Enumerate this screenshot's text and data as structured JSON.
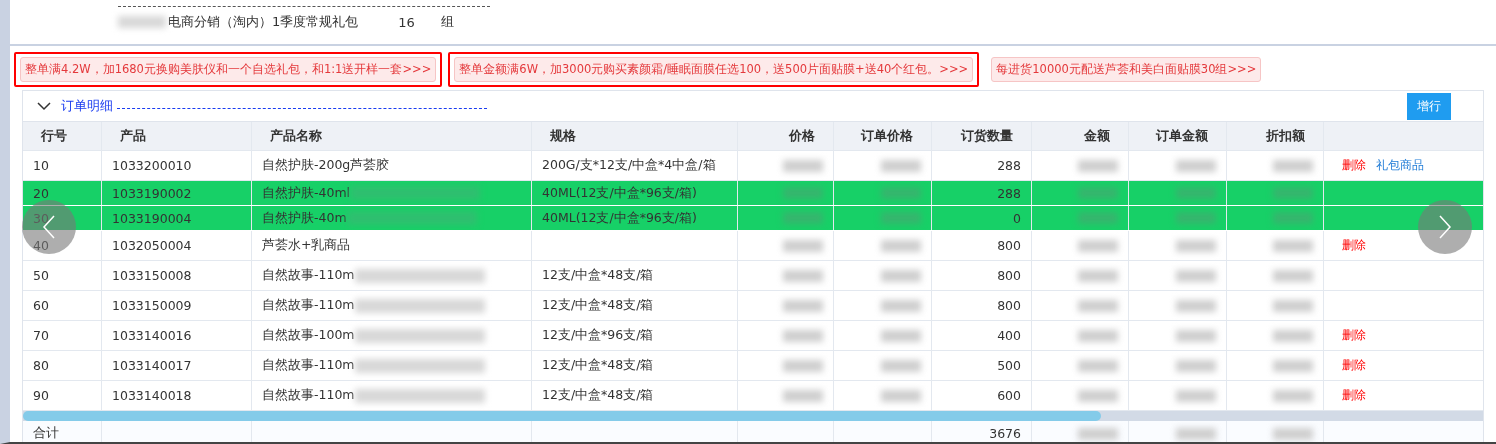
{
  "package": {
    "name": "电商分销（淘内）1季度常规礼包",
    "name_masked": true,
    "quantity": "16",
    "unit": "组"
  },
  "promotions": [
    {
      "text": "整单满4.2W，加1680元换购美肤仪和一个自选礼包，和1:1送开样一套>>>",
      "highlighted": true
    },
    {
      "text": "整单金额满6W，加3000元购买素颜霜/睡眠面膜任选100，送500片面贴膜+送40个红包。>>>",
      "highlighted": true
    },
    {
      "text": "每进货10000元配送芦荟和美白面贴膜30组>>>",
      "highlighted": false
    }
  ],
  "section": {
    "title": "订单明细",
    "expanded": true,
    "add_button": "增行"
  },
  "table": {
    "columns": [
      {
        "label": "行号",
        "masked": false
      },
      {
        "label": "产品",
        "masked": false
      },
      {
        "label": "产品名称",
        "masked": false
      },
      {
        "label": "规格",
        "masked": false
      },
      {
        "label": "价格",
        "masked": true
      },
      {
        "label": "订单价格",
        "masked": true
      },
      {
        "label": "订货数量",
        "masked": false
      },
      {
        "label": "金额",
        "masked": true
      },
      {
        "label": "订单金额",
        "masked": true
      },
      {
        "label": "折扣额",
        "masked": true
      }
    ],
    "rows": [
      {
        "line": "10",
        "product": "1033200010",
        "name": "自然护肤-200g芦荟胶",
        "name_masked": false,
        "spec": "200G/支*12支/中盒*4中盒/箱",
        "quantity": "288",
        "selected": false,
        "actions": [
          {
            "label": "删除",
            "kind": "delete"
          },
          {
            "label": "礼包商品",
            "kind": "link"
          }
        ]
      },
      {
        "line": "20",
        "product": "1033190002",
        "name": "自然护肤-40ml",
        "name_masked": true,
        "spec": "40ML(12支/中盒*96支/箱)",
        "quantity": "288",
        "selected": true,
        "actions": []
      },
      {
        "line": "30",
        "product": "1033190004",
        "name": "自然护肤-40m",
        "name_masked": true,
        "spec": "40ML(12支/中盒*96支/箱)",
        "quantity": "0",
        "selected": true,
        "actions": []
      },
      {
        "line": "40",
        "product": "1032050004",
        "name": "芦荟水+乳商品",
        "name_masked": false,
        "spec": "",
        "quantity": "800",
        "selected": false,
        "actions": [
          {
            "label": "删除",
            "kind": "delete"
          }
        ]
      },
      {
        "line": "50",
        "product": "1033150008",
        "name": "自然故事-110m",
        "name_masked": true,
        "spec": "12支/中盒*48支/箱",
        "quantity": "800",
        "selected": false,
        "actions": []
      },
      {
        "line": "60",
        "product": "1033150009",
        "name": "自然故事-110m",
        "name_masked": true,
        "spec": "12支/中盒*48支/箱",
        "quantity": "800",
        "selected": false,
        "actions": []
      },
      {
        "line": "70",
        "product": "1033140016",
        "name": "自然故事-100m",
        "name_masked": true,
        "spec": "12支/中盒*96支/箱",
        "quantity": "400",
        "selected": false,
        "actions": [
          {
            "label": "删除",
            "kind": "delete"
          }
        ]
      },
      {
        "line": "80",
        "product": "1033140017",
        "name": "自然故事-110m",
        "name_masked": true,
        "spec": "12支/中盒*48支/箱",
        "quantity": "500",
        "selected": false,
        "actions": [
          {
            "label": "删除",
            "kind": "delete"
          }
        ]
      },
      {
        "line": "90",
        "product": "1033140018",
        "name": "自然故事-110m",
        "name_masked": true,
        "spec": "12支/中盒*48支/箱",
        "quantity": "600",
        "selected": false,
        "actions": [
          {
            "label": "删除",
            "kind": "delete"
          }
        ]
      }
    ],
    "total": {
      "label": "合计",
      "quantity": "3676"
    }
  }
}
